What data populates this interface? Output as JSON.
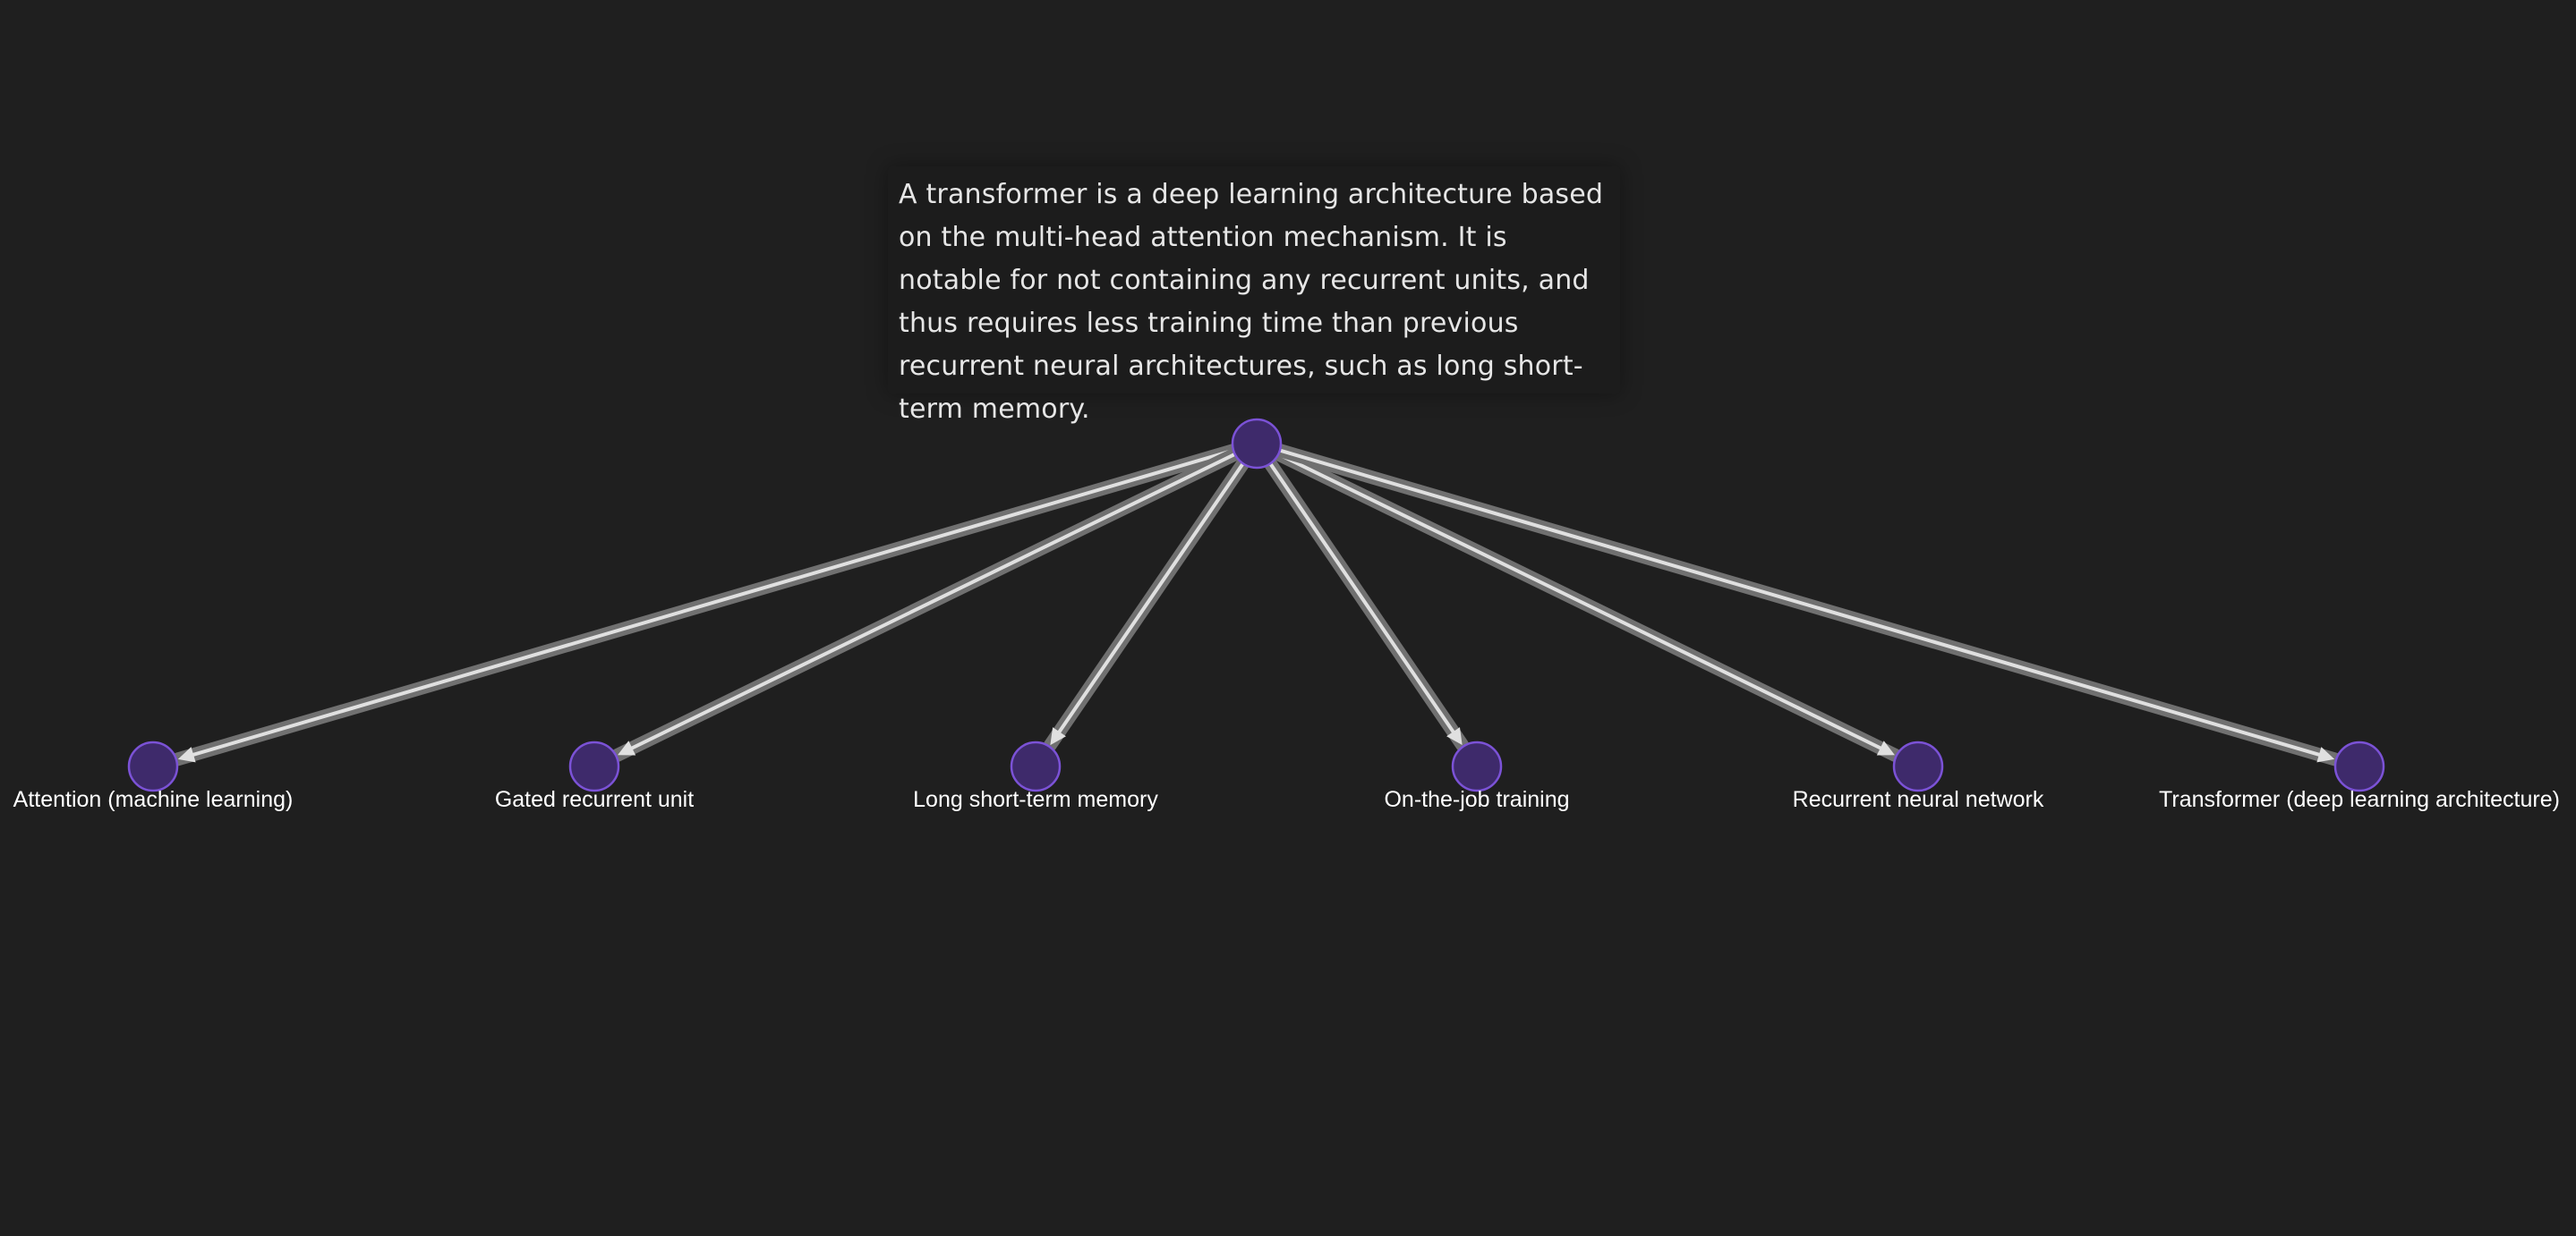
{
  "diagram": {
    "description_text": "A transformer is a deep learning architecture based on the multi-head attention mechanism. It is notable for not containing any recurrent units, and thus requires less training time than previous recurrent neural architectures, such as long short-term memory.",
    "nodes": [
      {
        "id": "n0",
        "label": "Attention (machine learning)"
      },
      {
        "id": "n1",
        "label": "Gated recurrent unit"
      },
      {
        "id": "n2",
        "label": "Long short-term memory"
      },
      {
        "id": "n3",
        "label": "On-the-job training"
      },
      {
        "id": "n4",
        "label": "Recurrent neural network"
      },
      {
        "id": "n5",
        "label": "Transformer (deep learning architecture)"
      }
    ],
    "edges": [
      {
        "from": "center",
        "to": "n0"
      },
      {
        "from": "center",
        "to": "n1"
      },
      {
        "from": "center",
        "to": "n2"
      },
      {
        "from": "center",
        "to": "n3"
      },
      {
        "from": "center",
        "to": "n4"
      },
      {
        "from": "center",
        "to": "n5"
      }
    ]
  },
  "colors": {
    "background": "#1f1f1f",
    "node_fill": "#3e2a6b",
    "node_stroke": "#7b52d6",
    "edge_outer": "#707070",
    "edge_inner": "#e0e0e0",
    "label_text": "#ffffff"
  }
}
